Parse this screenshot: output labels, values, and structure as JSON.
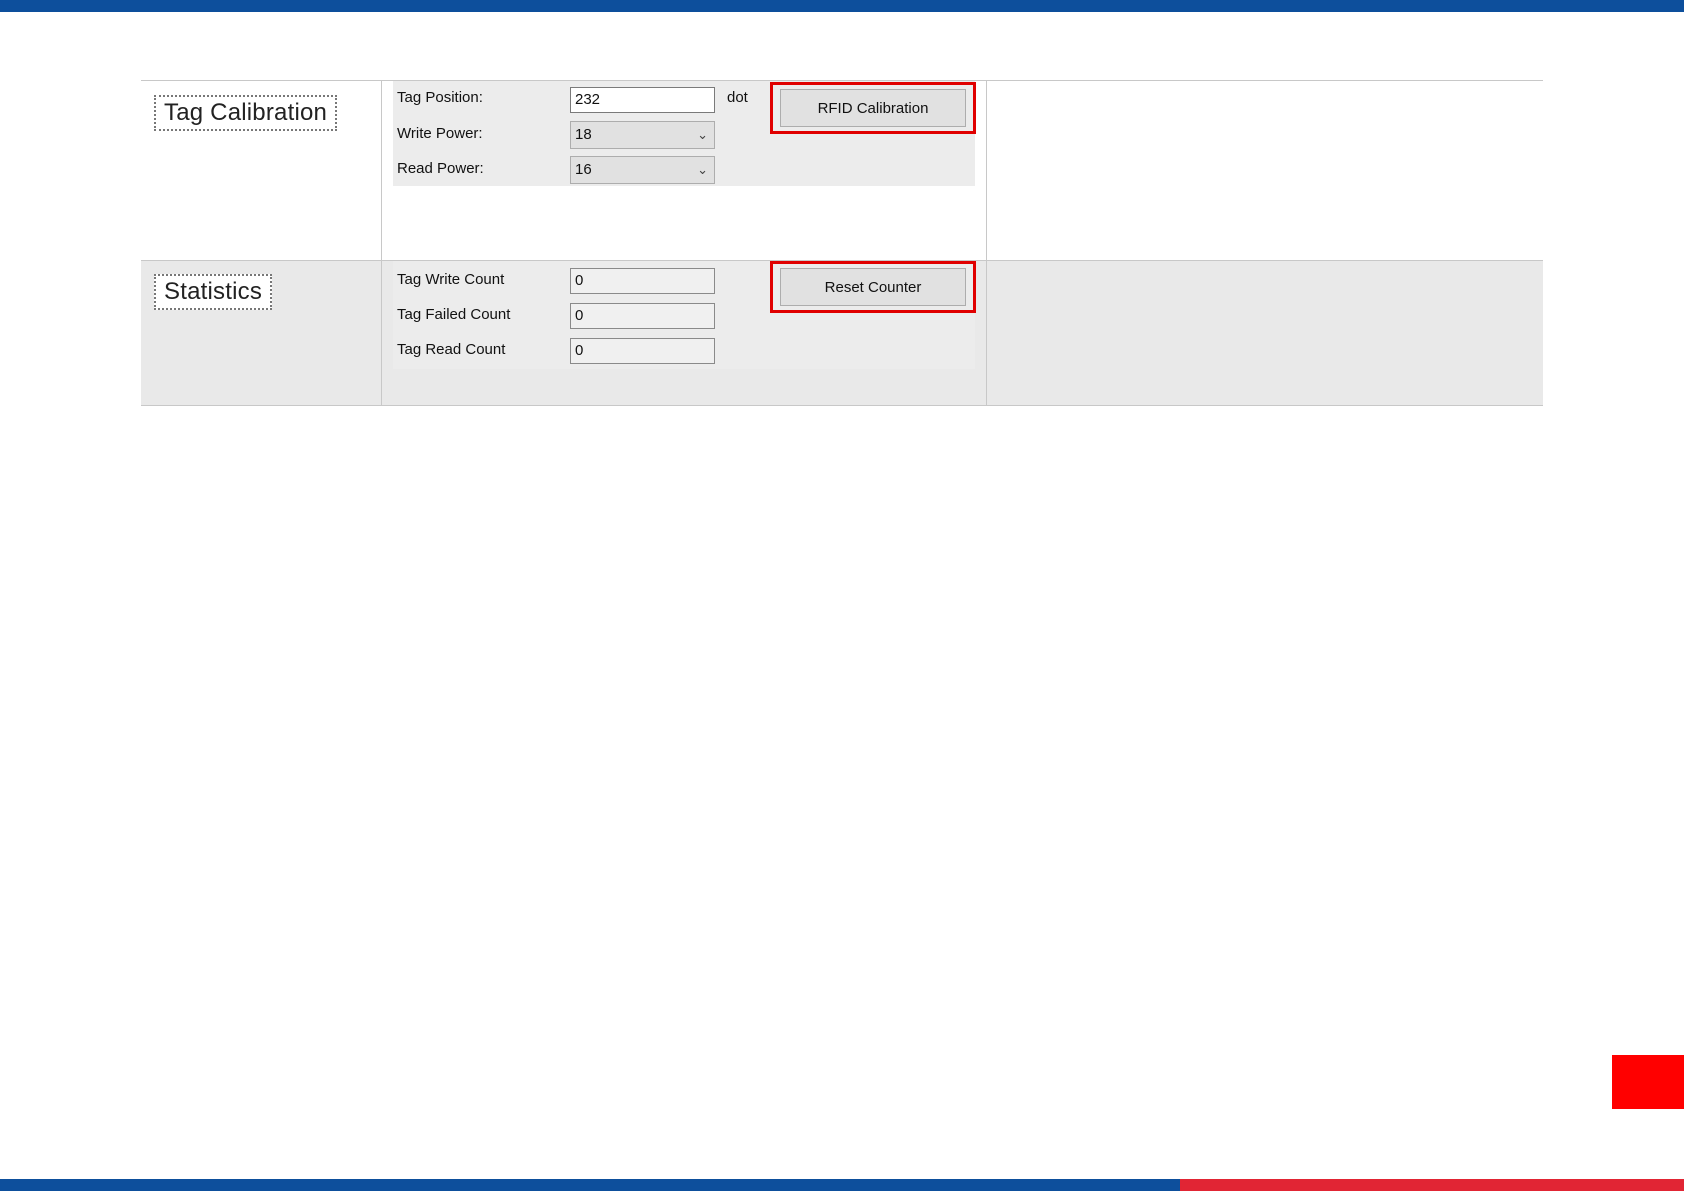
{
  "tag_calibration": {
    "title": "Tag Calibration",
    "tag_position_label": "Tag Position:",
    "tag_position_value": "232",
    "tag_position_unit": "dot",
    "write_power_label": "Write Power:",
    "write_power_value": "18",
    "read_power_label": "Read Power:",
    "read_power_value": "16",
    "calibration_button": "RFID Calibration"
  },
  "statistics": {
    "title": "Statistics",
    "write_count_label": "Tag Write Count",
    "write_count_value": "0",
    "failed_count_label": "Tag Failed Count",
    "failed_count_value": "0",
    "read_count_label": "Tag Read Count",
    "read_count_value": "0",
    "reset_button": "Reset Counter"
  },
  "colors": {
    "brand_blue": "#0d4f9c",
    "brand_red": "#e12534",
    "highlight_red": "#e00000"
  }
}
